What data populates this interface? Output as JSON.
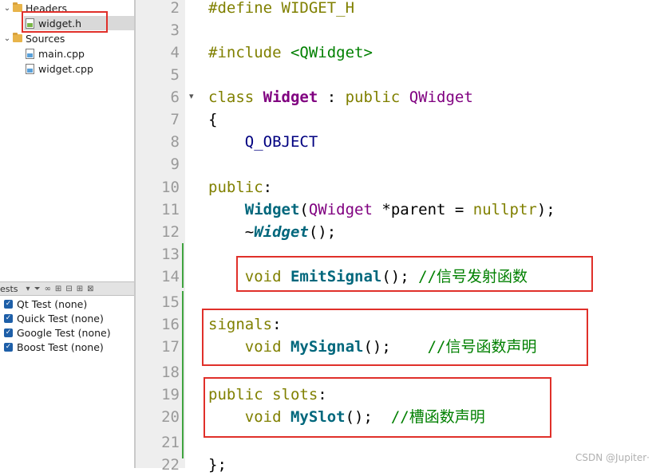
{
  "sidebar": {
    "tree": {
      "headers_label": "Headers",
      "widget_h": "widget.h",
      "sources_label": "Sources",
      "main_cpp": "main.cpp",
      "widget_cpp": "widget.cpp"
    },
    "tests": {
      "title": "ests",
      "items": [
        "Qt Test (none)",
        "Quick Test (none)",
        "Google Test (none)",
        "Boost Test (none)"
      ]
    }
  },
  "editor": {
    "line_numbers": [
      "2",
      "3",
      "4",
      "5",
      "6",
      "7",
      "8",
      "9",
      "10",
      "11",
      "12",
      "13",
      "14",
      "15",
      "16",
      "17",
      "18",
      "19",
      "20",
      "21",
      "22"
    ],
    "lines": {
      "l2": "#define WIDGET_H",
      "l4_kw": "#include ",
      "l4_inc": "<QWidget>",
      "l6_kw1": "class ",
      "l6_name": "Widget",
      "l6_mid": " : ",
      "l6_kw2": "public ",
      "l6_base": "QWidget",
      "l7": "{",
      "l8": "    Q_OBJECT",
      "l10": "public",
      "l10_colon": ":",
      "l11_indent": "    ",
      "l11_fn": "Widget",
      "l11_p1": "(",
      "l11_type": "QWidget",
      "l11_rest": " *parent = ",
      "l11_null": "nullptr",
      "l11_end": ");",
      "l12_indent": "    ~",
      "l12_fn": "Widget",
      "l12_end": "();",
      "l14_indent": "    ",
      "l14_void": "void ",
      "l14_fn": "EmitSignal",
      "l14_end": "(); ",
      "l14_cm": "//信号发射函数",
      "l16_kw": "signals",
      "l16_colon": ":",
      "l17_indent": "    ",
      "l17_void": "void ",
      "l17_fn": "MySignal",
      "l17_end": "();    ",
      "l17_cm": "//信号函数声明",
      "l19_kw": "public slots",
      "l19_colon": ":",
      "l20_indent": "    ",
      "l20_void": "void ",
      "l20_fn": "MySlot",
      "l20_end": "();  ",
      "l20_cm": "//槽函数声明",
      "l22": "};"
    }
  },
  "watermark": "CSDN @Jupiter·",
  "colors": {
    "highlight_border": "#e0302a",
    "keyword": "#808000",
    "class": "#800080",
    "function": "#00677c",
    "comment": "#008000"
  }
}
